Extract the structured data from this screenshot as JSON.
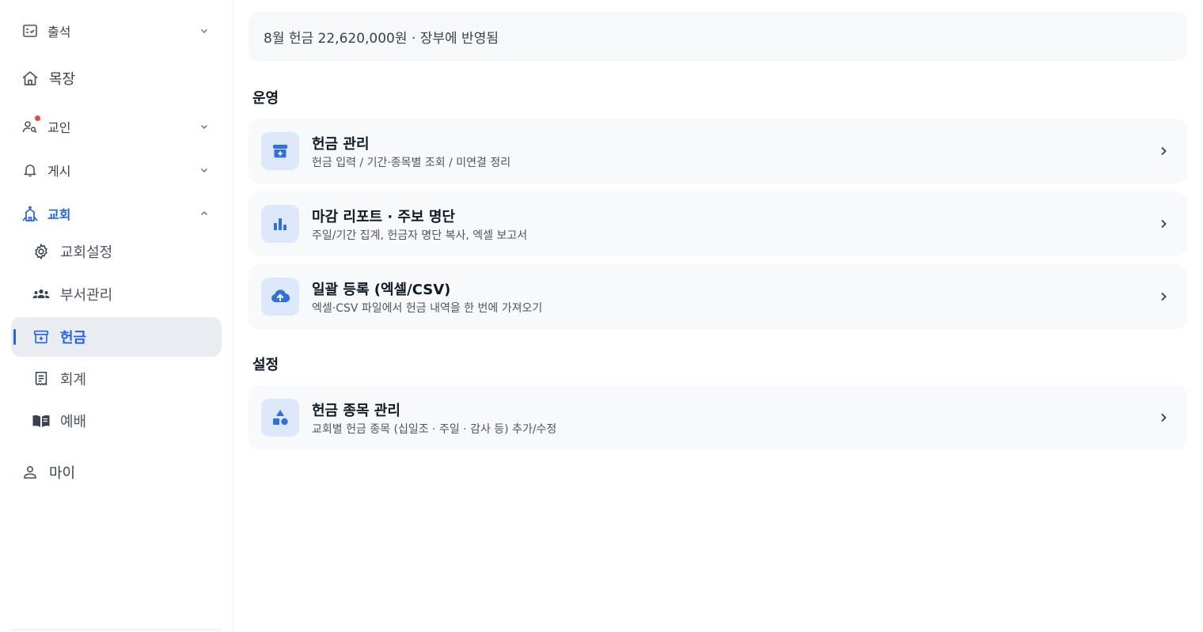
{
  "sidebar": {
    "items": [
      {
        "label": "출석",
        "icon": "attendance-checklist-icon",
        "expandable": true,
        "state": "collapsed"
      },
      {
        "label": "목장",
        "icon": "home-icon",
        "expandable": false
      },
      {
        "label": "교인",
        "icon": "member-search-icon",
        "expandable": true,
        "state": "collapsed",
        "notification_dot": true
      },
      {
        "label": "게시",
        "icon": "bell-icon",
        "expandable": true,
        "state": "collapsed"
      },
      {
        "label": "교회",
        "icon": "church-icon",
        "expandable": true,
        "state": "expanded"
      }
    ],
    "sub_items": [
      {
        "label": "교회설정",
        "icon": "gear-icon"
      },
      {
        "label": "부서관리",
        "icon": "group-icon"
      },
      {
        "label": "헌금",
        "icon": "offering-box-icon",
        "selected": true
      },
      {
        "label": "회계",
        "icon": "ledger-icon"
      },
      {
        "label": "예배",
        "icon": "book-icon"
      }
    ],
    "bottom_item": {
      "label": "마이",
      "icon": "user-icon"
    }
  },
  "main": {
    "summary": "8월 헌금 22,620,000원 · 장부에 반영됨",
    "sections": [
      {
        "title": "운영",
        "cards": [
          {
            "title": "헌금 관리",
            "desc": "헌금 입력 / 기간·종목별 조회 / 미연결 정리",
            "icon": "offering-box-icon"
          },
          {
            "title": "마감 리포트 · 주보 명단",
            "desc": "주일/기간 집계, 헌금자 명단 복사, 엑셀 보고서",
            "icon": "bar-chart-icon"
          },
          {
            "title": "일괄 등록 (엑셀/CSV)",
            "desc": "엑셀·CSV 파일에서 헌금 내역을 한 번에 가져오기",
            "icon": "cloud-upload-icon"
          }
        ]
      },
      {
        "title": "설정",
        "cards": [
          {
            "title": "헌금 종목 관리",
            "desc": "교회별 헌금 종목 (십일조 · 주일 · 감사 등) 추가/수정",
            "icon": "shapes-icon"
          }
        ]
      }
    ]
  },
  "colors": {
    "accent": "#2563eb",
    "selected_bg": "#e9ecf1",
    "card_bg": "#f8f9fb",
    "icon_box_bg": "#dde8fb",
    "badge": "#ef4444"
  }
}
